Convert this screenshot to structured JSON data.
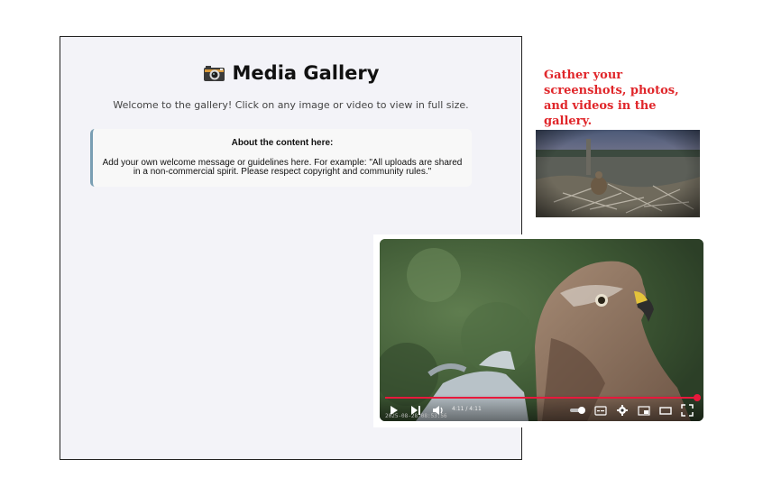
{
  "gallery": {
    "title": "Media Gallery",
    "title_icon": "camera-icon",
    "welcome": "Welcome to the gallery! Click on any image or video to view in full size.",
    "info_heading": "About the content here:",
    "info_text": "Add your own welcome message or guidelines here. For example: \"All uploads are shared in a non-commercial spirit. Please respect copyright and community rules.\""
  },
  "side": {
    "caption": "Gather your screenshots, photos, and videos in the gallery.",
    "caption_color": "#e0262a"
  },
  "video": {
    "progress": 1.0,
    "time": "4:11 / 4:11",
    "timestamp": "2025-08-28 08:53:56",
    "accent_color": "#e8193c",
    "controls": [
      "play-icon",
      "next-icon",
      "volume-icon",
      "autoplay-toggle-icon",
      "subtitles-icon",
      "settings-gear-icon",
      "miniplayer-icon",
      "theater-mode-icon",
      "fullscreen-icon"
    ]
  }
}
